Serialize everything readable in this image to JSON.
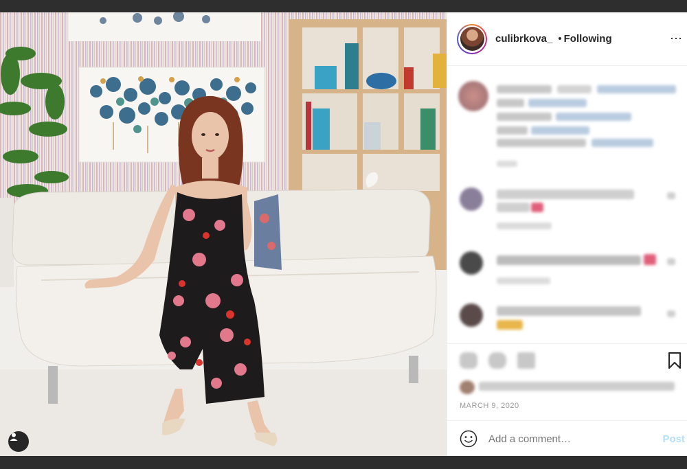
{
  "post": {
    "username": "culibrkova_",
    "separator": "•",
    "follow_status": "Following",
    "more_icon": "⋯",
    "date": "MARCH 9, 2020"
  },
  "comment_box": {
    "placeholder": "Add a comment…",
    "post_label": "Post"
  },
  "colors": {
    "accent_disabled": "#b2dffc",
    "text": "#262626",
    "muted": "#999999"
  },
  "icons": [
    "user-tag-icon",
    "emoji-icon",
    "like-icon",
    "comment-icon",
    "share-icon",
    "bookmark-icon",
    "more-options-icon"
  ]
}
